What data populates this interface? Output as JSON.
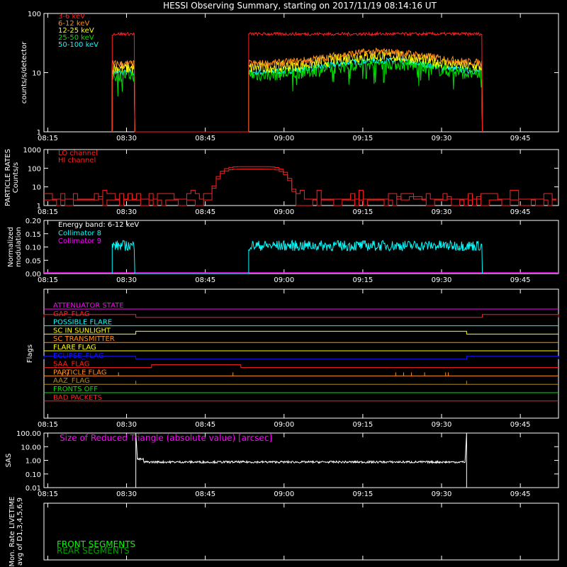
{
  "title": "HESSI Observing Summary, starting on 2017/11/19 08:14:16 UT",
  "colors": {
    "bg": "#000000",
    "axis": "#ffffff",
    "red": "#ff2020",
    "orange": "#ff8c1a",
    "yellow": "#ffff00",
    "green": "#00e000",
    "cyan": "#00ffff",
    "magenta": "#ff00ff",
    "blue": "#1414ff",
    "brown": "#b08a20",
    "front": "#00ff00",
    "rear": "#00a000"
  },
  "x_tick_labels": [
    "08:15",
    "08:30",
    "08:45",
    "09:00",
    "09:15",
    "09:30",
    "09:45"
  ],
  "chart_data": [
    {
      "type": "line",
      "name": "count-rates",
      "ylabel": "counts/s/detector",
      "yscale": "log",
      "ylim": [
        1,
        100
      ],
      "y_tick_labels": [
        "1",
        "10",
        "100"
      ],
      "x_range_min": [
        15,
        87
      ],
      "series": [
        {
          "name": "3-6 keV",
          "color": "red",
          "level": 45,
          "noise": 0.06
        },
        {
          "name": "6-12 keV",
          "color": "orange",
          "level": 14,
          "noise": 0.15
        },
        {
          "name": "12-25 keV",
          "color": "yellow",
          "level": 12,
          "noise": 0.22
        },
        {
          "name": "25-50 keV",
          "color": "green",
          "level": 9,
          "noise": 0.25
        },
        {
          "name": "50-100 keV",
          "color": "cyan",
          "level": 10,
          "noise": 0.12
        }
      ],
      "intervals_min": [
        [
          13,
          17.3
        ],
        [
          39,
          83.5
        ]
      ],
      "hump": {
        "center_min": 64,
        "width_min": 12,
        "factor": 1.6
      }
    },
    {
      "type": "line",
      "name": "particle-rates",
      "ylabel": "PARTICLE RATES\nCounts/s",
      "yscale": "log",
      "ylim": [
        1,
        1000
      ],
      "y_tick_labels": [
        "1",
        "10",
        "100",
        "1000"
      ],
      "series": [
        {
          "name": "LO channel",
          "color": "red"
        },
        {
          "name": "HI channel",
          "color": "red"
        }
      ],
      "peak_min": 39.5,
      "peak_value": 120
    },
    {
      "type": "line",
      "name": "modulation",
      "ylabel": "Normalized\nmodulation",
      "ylim": [
        0,
        0.2
      ],
      "y_tick_labels": [
        "0.00",
        "0.05",
        "0.10",
        "0.15",
        "0.20"
      ],
      "legend_header": "Energy band: 6-12 keV",
      "series": [
        {
          "name": "Collimator 8",
          "color": "cyan",
          "level": 0.1
        },
        {
          "name": "Collimator 9",
          "color": "magenta",
          "level": 0.0
        }
      ]
    },
    {
      "type": "line",
      "name": "flags",
      "ylabel": "Flags",
      "flags": [
        {
          "name": "ATTENUATOR STATE",
          "color": "magenta"
        },
        {
          "name": "GAP_FLAG",
          "color": "red",
          "on": [
            [
              0,
              17.5
            ],
            [
              83.5,
              98
            ]
          ]
        },
        {
          "name": "POSSIBLE FLARE",
          "color": "cyan"
        },
        {
          "name": "SC IN SUNLIGHT",
          "color": "yellow",
          "on": [
            [
              17.5,
              80.5
            ]
          ]
        },
        {
          "name": "SC TRANSMITTER",
          "color": "orange"
        },
        {
          "name": "FLARE FLAG",
          "color": "yellow"
        },
        {
          "name": "ECLIPSE_FLAG",
          "color": "blue",
          "on": [
            [
              0,
              17.5
            ],
            [
              80.5,
              98
            ]
          ]
        },
        {
          "name": "SAA_FLAG",
          "color": "red",
          "on": [
            [
              20.5,
              37.5
            ]
          ]
        },
        {
          "name": "PARTICLE FLAG",
          "color": "orange",
          "spikes": [
            3.5,
            4.5,
            14.2,
            36,
            67,
            68.5,
            70,
            72.5,
            76.5,
            77
          ]
        },
        {
          "name": "AAZ_FLAG",
          "color": "brown",
          "spikes": [
            17.5,
            80.5
          ]
        },
        {
          "name": "FRONTS OFF",
          "color": "green"
        },
        {
          "name": "BAD PACKETS",
          "color": "red"
        }
      ]
    },
    {
      "type": "line",
      "name": "sas",
      "ylabel": "SAS",
      "yscale": "log",
      "ylim": [
        0.01,
        100
      ],
      "y_tick_labels": [
        "0.01",
        "0.10",
        "1.00",
        "10.00",
        "100.00"
      ],
      "annotation": "Size of Reduced Triangle (absolute value) [arcsec]",
      "level": 0.75,
      "interval_min": [
        17.5,
        80.5
      ]
    },
    {
      "type": "line",
      "name": "livetime",
      "ylabel": "Mon. Rate LIVETIME\navg of D1,3,4,5,6,9",
      "series": [
        {
          "name": "FRONT SEGMENTS",
          "color": "front"
        },
        {
          "name": "REAR SEGMENTS",
          "color": "rear"
        }
      ]
    }
  ]
}
